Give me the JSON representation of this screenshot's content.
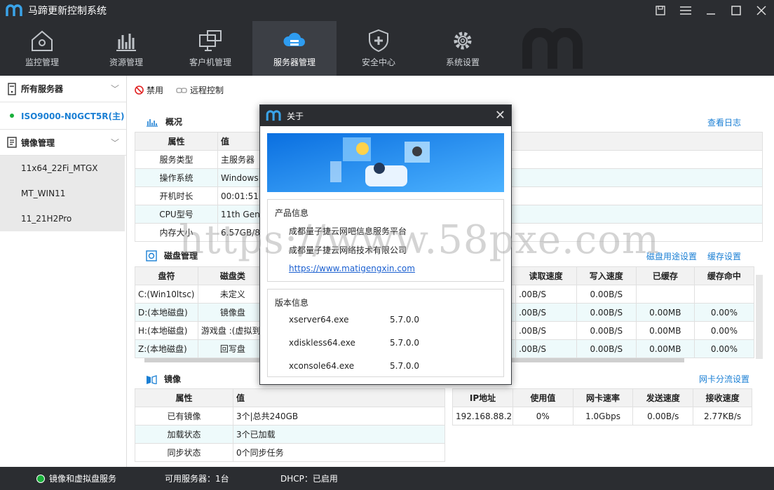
{
  "app": {
    "title": "马蹄更新控制系统"
  },
  "nav": [
    {
      "label": "监控管理",
      "icon": "monitor-house-icon"
    },
    {
      "label": "资源管理",
      "icon": "bar-chart-icon"
    },
    {
      "label": "客户机管理",
      "icon": "desktop-computers-icon"
    },
    {
      "label": "服务器管理",
      "icon": "cloud-server-icon",
      "active": true
    },
    {
      "label": "安全中心",
      "icon": "shield-plus-icon"
    },
    {
      "label": "系统设置",
      "icon": "gear-icon"
    }
  ],
  "sidebar": {
    "servers_group": "所有服务器",
    "server": "ISO9000-N0GCT5R(主)",
    "images_group": "镜像管理",
    "images": [
      "11x64_22Fi_MTGX",
      "MT_WIN11",
      "11_21H2Pro"
    ]
  },
  "toolbar": {
    "disable": "禁用",
    "remote": "远程控制"
  },
  "overview": {
    "title": "概况",
    "view_log": "查看日志",
    "headers": [
      "属性",
      "值"
    ],
    "rows": [
      [
        "服务类型",
        "主服务器"
      ],
      [
        "操作系统",
        "Windows"
      ],
      [
        "开机时长",
        "00:01:51"
      ],
      [
        "CPU型号",
        "11th Gen"
      ],
      [
        "内存大小",
        "6.57GB/8."
      ]
    ]
  },
  "disk": {
    "title": "磁盘管理",
    "link1": "磁盘用途设置",
    "link2": "缓存设置",
    "headers": [
      "盘符",
      "磁盘类",
      "读取速度",
      "写入速度",
      "已缓存",
      "缓存命中"
    ],
    "rows": [
      [
        "C:(Win10ltsc)",
        "未定义",
        ".00B/S",
        "0.00B/S",
        "",
        ""
      ],
      [
        "D:(本地磁盘)",
        "镜像盘",
        ".00B/S",
        "0.00B/S",
        "0.00MB",
        "0.00%"
      ],
      [
        "H:(本地磁盘)",
        "游戏盘 :(虚拟到",
        ".00B/S",
        "0.00B/S",
        "0.00MB",
        "0.00%"
      ],
      [
        "Z:(本地磁盘)",
        "回写盘",
        ".00B/S",
        "0.00B/S",
        "0.00MB",
        "0.00%"
      ]
    ]
  },
  "mirror": {
    "title": "镜像",
    "headers": [
      "属性",
      "值"
    ],
    "rows": [
      [
        "已有镜像",
        "3个|总共240GB"
      ],
      [
        "加载状态",
        "3个已加载"
      ],
      [
        "同步状态",
        "0个同步任务"
      ]
    ]
  },
  "nic": {
    "link": "网卡分流设置",
    "headers": [
      "IP地址",
      "使用值",
      "网卡速率",
      "发送速度",
      "接收速度"
    ],
    "rows": [
      [
        "192.168.88.230",
        "0%",
        "1.0Gbps",
        "0.00B/s",
        "2.77KB/s"
      ]
    ]
  },
  "status": {
    "service": "镜像和虚拟盘服务",
    "servers": "可用服务器：1台",
    "dhcp": "DHCP：已启用"
  },
  "about": {
    "title": "关于",
    "product_heading": "产品信息",
    "company1": "成都量子捷云网吧信息服务平台",
    "company2": "成都量子捷云网络技术有限公司",
    "url": "https://www.matigengxin.com",
    "version_heading": "版本信息",
    "versions": [
      {
        "name": "xserver64.exe",
        "ver": "5.7.0.0"
      },
      {
        "name": "xdiskless64.exe",
        "ver": "5.7.0.0"
      },
      {
        "name": "xconsole64.exe",
        "ver": "5.7.0.0"
      }
    ]
  },
  "watermark": "https://www.58pxe.com",
  "colors": {
    "titlebar": "#2b2d31",
    "accent": "#1a7fd4",
    "online": "#19b03a"
  }
}
